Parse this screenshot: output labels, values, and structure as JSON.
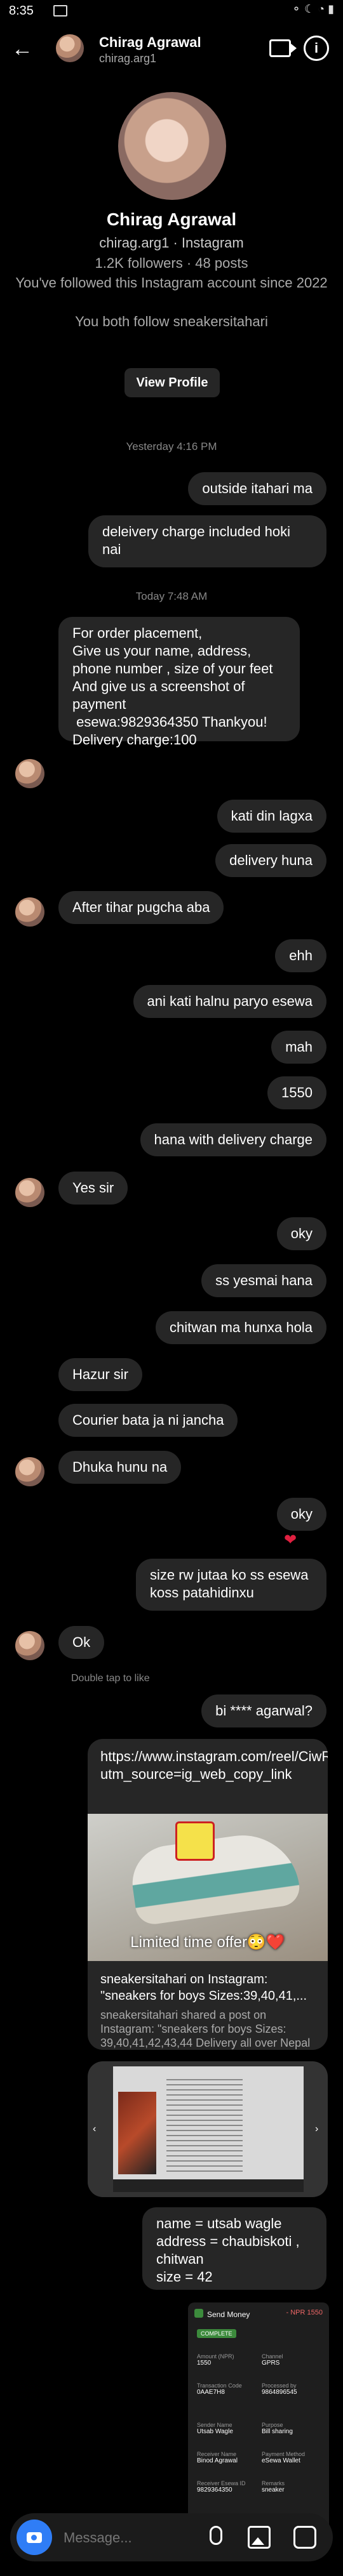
{
  "status_bar": {
    "time": "8:35",
    "icons": "⚬ ☾ ◔ ▮"
  },
  "header": {
    "name": "Chirag Agrawal",
    "username": "chirag.arg1",
    "back_icon": "←",
    "info_icon": "i"
  },
  "profile": {
    "name": "Chirag Agrawal",
    "subtitle": "chirag.arg1 · Instagram",
    "stats": "1.2K followers · 48 posts",
    "followed_since": "You've followed this Instagram account since 2022",
    "mutual": "You both follow sneakersitahari",
    "view_profile": "View Profile"
  },
  "timestamps": {
    "t1": "Yesterday 4:16 PM",
    "t2": "Today 7:48 AM"
  },
  "messages": [
    "outside itahari ma",
    "deleivery charge included hoki nai",
    "For order placement,\nGive us your name, address, phone number , size of your feet\nAnd give us a screenshot of payment\n esewa:9829364350 Thankyou!\nDelivery charge:100",
    "kati din lagxa",
    "delivery huna",
    "After tihar pugcha aba",
    "ehh",
    "ani kati halnu paryo esewa",
    "mah",
    "1550",
    "hana with delivery charge",
    "Yes sir",
    "oky",
    "ss yesmai hana",
    "chitwan ma hunxa hola",
    "Hazur sir",
    "Courier bata ja ni jancha",
    "Dhuka hunu na",
    "oky",
    "size rw jutaa ko ss esewa koss patahidinxu",
    "Ok",
    "bi **** agarwal?",
    "name = utsab wagle\naddress = chaubiskoti , chitwan\nsize = 42"
  ],
  "reaction": "❤",
  "double_tap": "Double tap to like",
  "link": {
    "url": "https://www.instagram.com/reel/CiwRFqHDfny/?utm_source=ig_web_copy_link",
    "overlay": "Limited time offer😳❤️",
    "sender": "sneakersitahari on Instagram: \"sneakers for boys Sizes:39,40,41,...",
    "desc": "sneakersitahari shared a post on Instagram: \"sneakers for boys Sizes: 39,40,41,42,43,44 Delivery all over Nepal ..."
  },
  "payment": {
    "title": "Send Money",
    "amount": "- NPR 1550",
    "status": "COMPLETE",
    "fields": [
      {
        "k": "Amount (NPR)",
        "v": "1550"
      },
      {
        "k": "Channel",
        "v": "GPRS"
      },
      {
        "k": "Transaction Code",
        "v": "0AAE7H8"
      },
      {
        "k": "Processed by",
        "v": "9864896545"
      },
      {
        "k": "Sender Name",
        "v": "Utsab Wagle"
      },
      {
        "k": "Purpose",
        "v": "Bill sharing"
      },
      {
        "k": "Receiver Name",
        "v": "Binod Agrawal"
      },
      {
        "k": "Payment Method",
        "v": "eSewa Wallet"
      },
      {
        "k": "Receiver Esewa ID",
        "v": "9829364350"
      },
      {
        "k": "Remarks",
        "v": "sneaker"
      }
    ]
  },
  "composer": {
    "placeholder": "Message..."
  },
  "colors": {
    "bubble": "#262626",
    "accent": "#2f7df6",
    "background": "#000000"
  }
}
